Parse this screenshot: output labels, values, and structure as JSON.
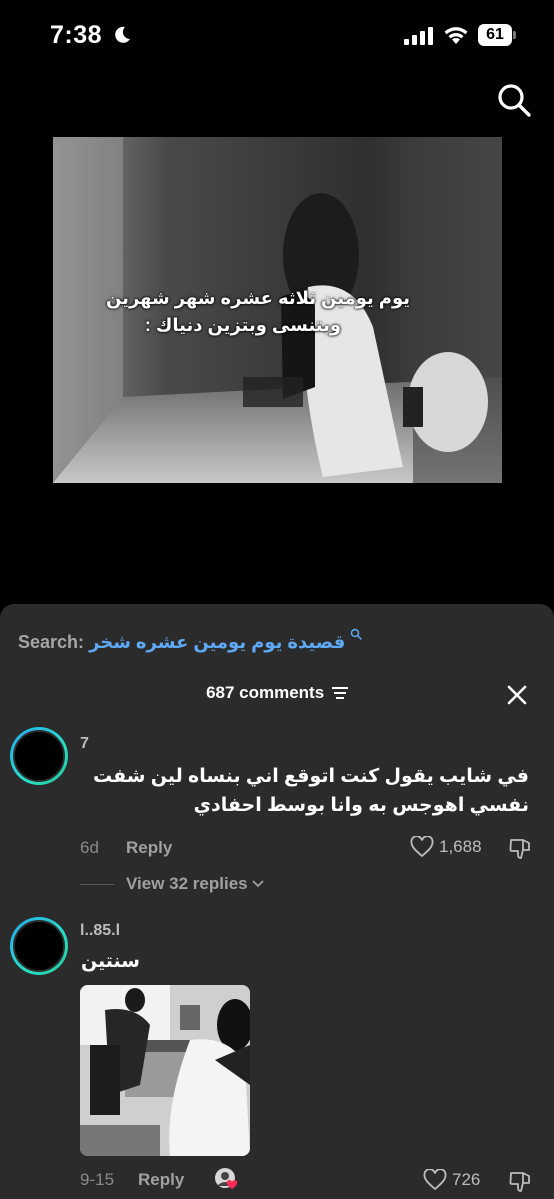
{
  "status_bar": {
    "time": "7:38",
    "battery": "61"
  },
  "video": {
    "caption_line1": "يوم يومين ثلاثه عشره شهر شهرين",
    "caption_line2": "وبتنسى وبتزين دنياك :"
  },
  "comments_sheet": {
    "search_label": "Search:",
    "search_query": "قصيدة يوم يومين عشره شخر",
    "header_title": "687 comments",
    "comments": [
      {
        "username": "7",
        "text": "في شايب يقول كنت اتوقع اني بنساه لين شفت نفسي اهوجس به وانا بوسط احفادي",
        "age": "6d",
        "reply_label": "Reply",
        "likes": "1,688",
        "view_replies": "View 32 replies"
      },
      {
        "username": "l..85.l",
        "text": "سنتين",
        "age": "9-15",
        "reply_label": "Reply",
        "likes": "726"
      }
    ]
  }
}
